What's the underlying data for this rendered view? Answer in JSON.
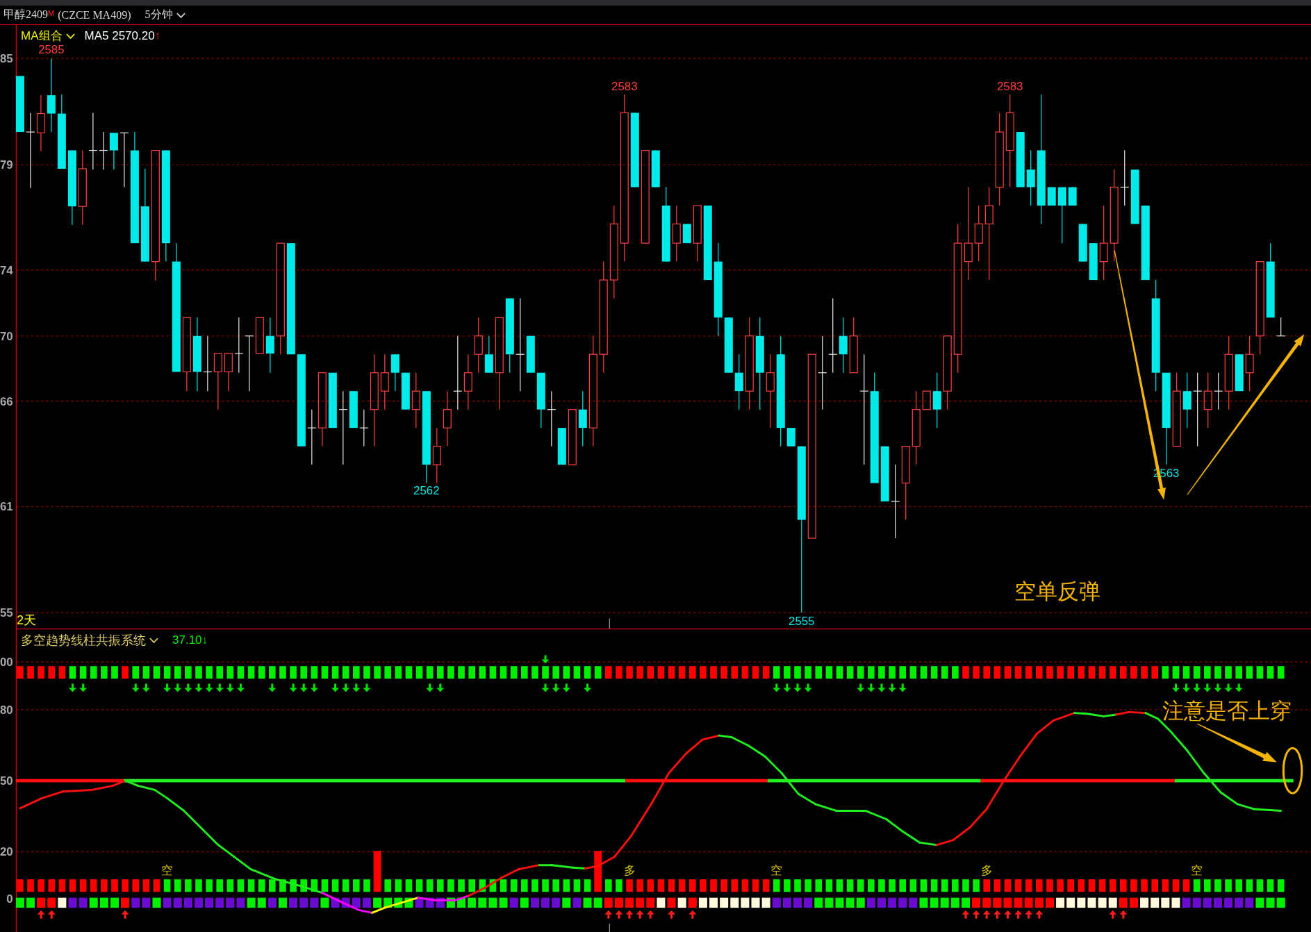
{
  "header": {
    "symbol": "甲醇2409",
    "contract_mark": "M",
    "code": "(CZCE MA409)",
    "period": "5分钟"
  },
  "price_panel": {
    "indicator": "MA组合",
    "ma_reading": "MA5 2570.20",
    "ma_trend": "↑",
    "y_labels": [
      "85",
      "79",
      "74",
      "70",
      "66",
      "61",
      "55"
    ],
    "extreme_labels": [
      {
        "text": "2585",
        "kind": "high"
      },
      {
        "text": "2583",
        "kind": "high"
      },
      {
        "text": "2583",
        "kind": "high"
      },
      {
        "text": "2562",
        "kind": "low"
      },
      {
        "text": "2555",
        "kind": "low"
      },
      {
        "text": "2563",
        "kind": "low"
      }
    ],
    "range_label": "2天",
    "annotation": "空单反弹"
  },
  "indicator_panel": {
    "title": "多空趋势线柱共振系统",
    "reading": "37.10",
    "reading_trend": "↓",
    "y_labels": [
      "00",
      "80",
      "50",
      "20",
      "0"
    ],
    "signal_labels": [
      "空",
      "多",
      "空",
      "多",
      "空"
    ],
    "annotation": "注意是否上穿"
  }
}
